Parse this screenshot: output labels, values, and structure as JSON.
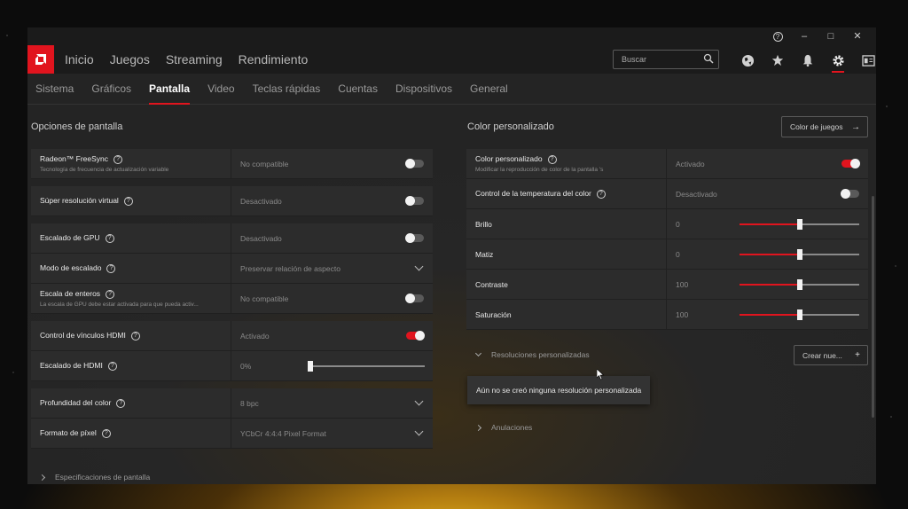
{
  "window": {
    "help": "?",
    "minimize": "–",
    "maximize": "□",
    "close": "✕"
  },
  "nav": {
    "items": [
      "Inicio",
      "Juegos",
      "Streaming",
      "Rendimiento"
    ],
    "search_placeholder": "Buscar",
    "icons": [
      "globe-icon",
      "star-icon",
      "bell-icon",
      "gear-icon",
      "layout-icon"
    ]
  },
  "tabs": [
    "Sistema",
    "Gráficos",
    "Pantalla",
    "Video",
    "Teclas rápidas",
    "Cuentas",
    "Dispositivos",
    "General"
  ],
  "active_tab": "Pantalla",
  "left": {
    "title": "Opciones de pantalla",
    "freesync": {
      "label": "Radeon™ FreeSync",
      "desc": "Tecnología de frecuencia de actualización variable",
      "value": "No compatible",
      "on": false
    },
    "vsr": {
      "label": "Súper resolución virtual",
      "value": "Desactivado",
      "on": false
    },
    "gpu_scaling": {
      "label": "Escalado de GPU",
      "value": "Desactivado",
      "on": false
    },
    "scaling_mode": {
      "label": "Modo de escalado",
      "value": "Preservar relación de aspecto"
    },
    "integer_scaling": {
      "label": "Escala de enteros",
      "desc": "La escala de GPU debe estar activada para que pueda activ...",
      "value": "No compatible",
      "on": false
    },
    "hdmi_link": {
      "label": "Control de vínculos HDMI",
      "value": "Activado",
      "on": true
    },
    "hdmi_scaling": {
      "label": "Escalado de HDMI",
      "value": "0%",
      "level": 0
    },
    "color_depth": {
      "label": "Profundidad del color",
      "value": "8 bpc"
    },
    "pixel_format": {
      "label": "Formato de píxel",
      "value": "YCbCr 4:4:4 Pixel Format"
    },
    "specs": "Especificaciones de pantalla"
  },
  "right": {
    "title": "Color personalizado",
    "game_color_button": "Color de juegos",
    "custom_color": {
      "label": "Color personalizado",
      "desc": "Modificar la reproducción de color de la pantalla 's",
      "value": "Activado",
      "on": true
    },
    "color_temp": {
      "label": "Control de la temperatura del color",
      "value": "Desactivado",
      "on": false
    },
    "brightness": {
      "label": "Brillo",
      "value": "0",
      "level": 0.5
    },
    "hue": {
      "label": "Matiz",
      "value": "0",
      "level": 0.5
    },
    "contrast": {
      "label": "Contraste",
      "value": "100",
      "level": 0.5
    },
    "saturation": {
      "label": "Saturación",
      "value": "100",
      "level": 0.5
    },
    "custom_res": "Resoluciones personalizadas",
    "create_button": "Crear nue...",
    "no_res_message": "Aún no se creó ninguna resolución personalizada",
    "overrides": "Anulaciones"
  },
  "colors": {
    "accent": "#e1141e"
  }
}
